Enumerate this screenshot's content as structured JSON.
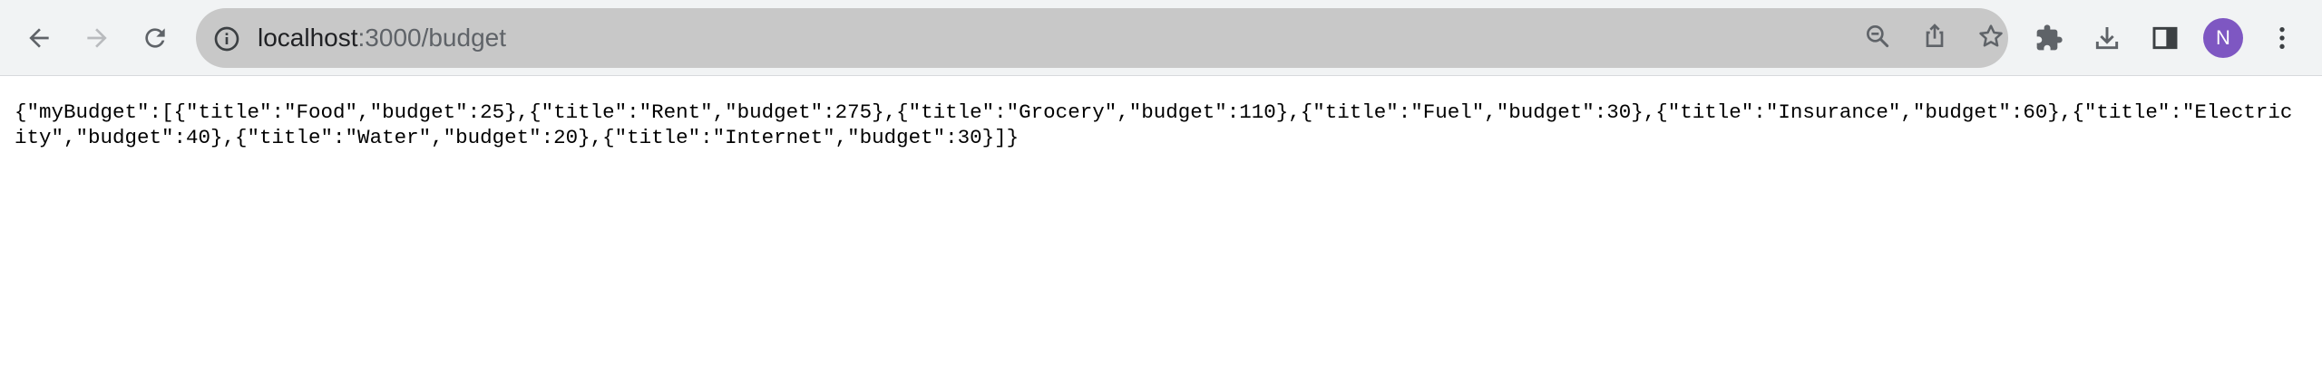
{
  "browser": {
    "address_bar": {
      "host": "localhost",
      "path": ":3000/budget"
    },
    "avatar_initial": "N",
    "accent_color": "#7e57c2",
    "icons": {
      "back": "arrow-left-icon",
      "forward": "arrow-right-icon",
      "reload": "reload-icon",
      "site_info": "info-circle-icon",
      "zoom": "zoom-out-icon",
      "share": "share-icon",
      "bookmark": "star-icon",
      "extensions": "puzzle-icon",
      "downloads": "download-icon",
      "side_panel": "side-panel-icon",
      "menu": "kebab-menu-icon"
    }
  },
  "page": {
    "json_text": "{\"myBudget\":[{\"title\":\"Food\",\"budget\":25},{\"title\":\"Rent\",\"budget\":275},{\"title\":\"Grocery\",\"budget\":110},{\"title\":\"Fuel\",\"budget\":30},{\"title\":\"Insurance\",\"budget\":60},{\"title\":\"Electricity\",\"budget\":40},{\"title\":\"Water\",\"budget\":20},{\"title\":\"Internet\",\"budget\":30}]}"
  }
}
